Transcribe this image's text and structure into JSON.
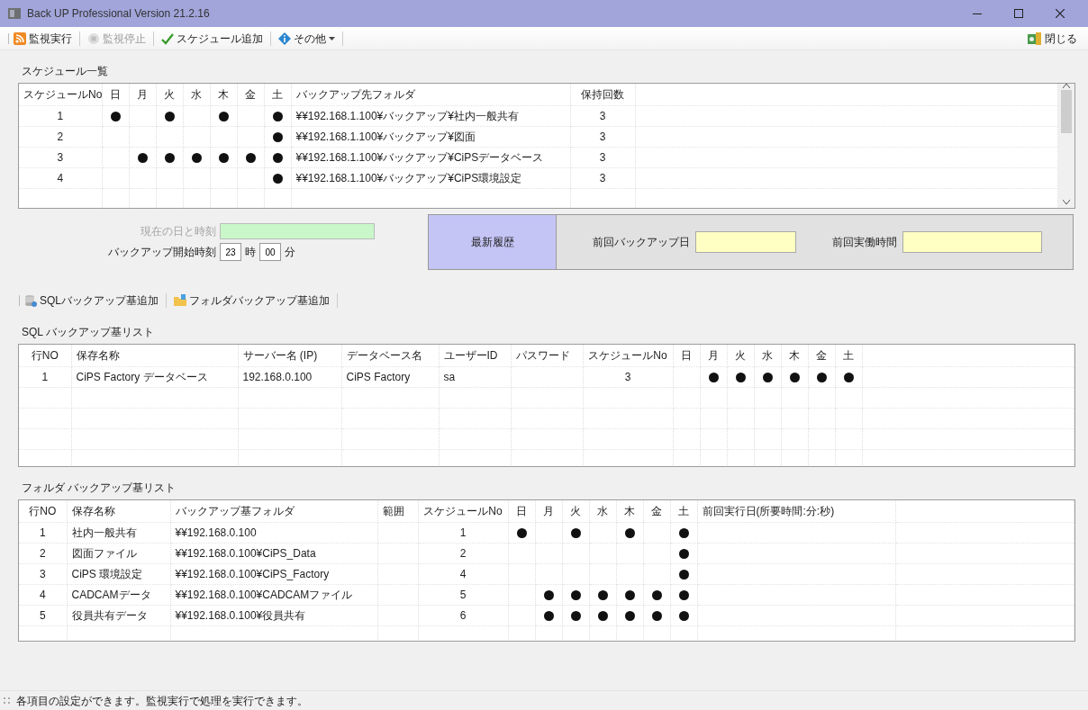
{
  "window": {
    "title": "Back UP Professional Version 21.2.16"
  },
  "toolbar": {
    "items": [
      {
        "label": "監視実行",
        "kind": "run",
        "disabled": false
      },
      {
        "label": "監視停止",
        "kind": "stop",
        "disabled": true
      },
      {
        "label": "スケジュール追加",
        "kind": "add",
        "disabled": false
      },
      {
        "label": "その他",
        "kind": "menu",
        "disabled": false
      }
    ],
    "close_label": "閉じる"
  },
  "schedule": {
    "title": "スケジュール一覧",
    "columns": [
      {
        "label": "スケジュールNo",
        "kind": "num"
      },
      {
        "label": "日",
        "kind": "day"
      },
      {
        "label": "月",
        "kind": "day"
      },
      {
        "label": "火",
        "kind": "day"
      },
      {
        "label": "水",
        "kind": "day"
      },
      {
        "label": "木",
        "kind": "day"
      },
      {
        "label": "金",
        "kind": "day"
      },
      {
        "label": "土",
        "kind": "day"
      },
      {
        "label": "バックアップ先フォルダ",
        "kind": "text"
      },
      {
        "label": "保持回数",
        "kind": "num"
      }
    ],
    "rows": [
      [
        "1",
        true,
        false,
        true,
        false,
        true,
        false,
        true,
        "¥¥192.168.1.100¥バックアップ¥社内一般共有",
        "3"
      ],
      [
        "2",
        false,
        false,
        false,
        false,
        false,
        false,
        true,
        "¥¥192.168.1.100¥バックアップ¥図面",
        "3"
      ],
      [
        "3",
        false,
        true,
        true,
        true,
        true,
        true,
        true,
        "¥¥192.168.1.100¥バックアップ¥CiPSデータベース",
        "3"
      ],
      [
        "4",
        false,
        false,
        false,
        false,
        false,
        false,
        true,
        "¥¥192.168.1.100¥バックアップ¥CiPS環境設定",
        "3"
      ]
    ]
  },
  "time_panel": {
    "current_label": "現在の日と時刻",
    "current_disabled": true,
    "start_label": "バックアップ開始時刻",
    "hour": "23",
    "hour_unit": "時",
    "minute": "00",
    "minute_unit": "分"
  },
  "history": {
    "title": "最新履歴",
    "last_backup_label": "前回バックアップ日",
    "last_runtime_label": "前回実働時間"
  },
  "sub_toolbar": [
    {
      "label": "SQLバックアップ基追加",
      "kind": "sql"
    },
    {
      "label": "フォルダバックアップ基追加",
      "kind": "folder"
    }
  ],
  "sql_list": {
    "title": "SQL バックアップ基リスト",
    "columns": [
      {
        "label": "行NO",
        "kind": "num"
      },
      {
        "label": "保存名称",
        "kind": "text"
      },
      {
        "label": "サーバー名 (IP)",
        "kind": "text"
      },
      {
        "label": "データベース名",
        "kind": "text"
      },
      {
        "label": "ユーザーID",
        "kind": "text"
      },
      {
        "label": "パスワード",
        "kind": "text"
      },
      {
        "label": "スケジュールNo",
        "kind": "num"
      },
      {
        "label": "日",
        "kind": "day"
      },
      {
        "label": "月",
        "kind": "day"
      },
      {
        "label": "火",
        "kind": "day"
      },
      {
        "label": "水",
        "kind": "day"
      },
      {
        "label": "木",
        "kind": "day"
      },
      {
        "label": "金",
        "kind": "day"
      },
      {
        "label": "土",
        "kind": "day"
      }
    ],
    "rows": [
      [
        "1",
        "CiPS Factory データベース",
        "192.168.0.100",
        "CiPS Factory",
        "sa",
        null,
        "3",
        false,
        true,
        true,
        true,
        true,
        true,
        true
      ]
    ]
  },
  "folder_list": {
    "title": "フォルダ バックアップ基リスト",
    "columns": [
      {
        "label": "行NO",
        "kind": "num"
      },
      {
        "label": "保存名称",
        "kind": "text"
      },
      {
        "label": "バックアップ基フォルダ",
        "kind": "text"
      },
      {
        "label": "範囲",
        "kind": "text"
      },
      {
        "label": "スケジュールNo",
        "kind": "num"
      },
      {
        "label": "日",
        "kind": "day"
      },
      {
        "label": "月",
        "kind": "day"
      },
      {
        "label": "火",
        "kind": "day"
      },
      {
        "label": "水",
        "kind": "day"
      },
      {
        "label": "木",
        "kind": "day"
      },
      {
        "label": "金",
        "kind": "day"
      },
      {
        "label": "土",
        "kind": "day"
      },
      {
        "label": "前回実行日(所要時間:分:秒)",
        "kind": "text"
      }
    ],
    "rows": [
      [
        "1",
        "社内一般共有",
        "¥¥192.168.0.100",
        null,
        "1",
        true,
        false,
        true,
        false,
        true,
        false,
        true,
        null
      ],
      [
        "2",
        "図面ファイル",
        "¥¥192.168.0.100¥CiPS_Data",
        null,
        "2",
        false,
        false,
        false,
        false,
        false,
        false,
        true,
        null
      ],
      [
        "3",
        "CiPS 環境設定",
        "¥¥192.168.0.100¥CiPS_Factory",
        null,
        "4",
        false,
        false,
        false,
        false,
        false,
        false,
        true,
        null
      ],
      [
        "4",
        "CADCAMデータ",
        "¥¥192.168.0.100¥CADCAMファイル",
        null,
        "5",
        false,
        true,
        true,
        true,
        true,
        true,
        true,
        null
      ],
      [
        "5",
        "役員共有データ",
        "¥¥192.168.0.100¥役員共有",
        null,
        "6",
        false,
        true,
        true,
        true,
        true,
        true,
        true,
        null
      ]
    ]
  },
  "status_bar": {
    "text": "各項目の設定ができます。監視実行で処理を実行できます。"
  }
}
